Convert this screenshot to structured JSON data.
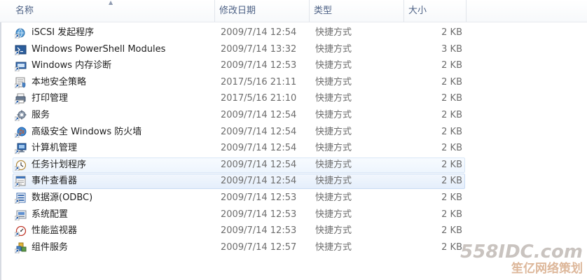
{
  "columns": {
    "name": "名称",
    "date": "修改日期",
    "type": "类型",
    "size": "大小"
  },
  "rows": [
    {
      "name": "iSCSI 发起程序",
      "date": "2009/7/14 12:54",
      "type": "快捷方式",
      "size": "2 KB",
      "icon": "iscsi-globe-icon",
      "state": "normal"
    },
    {
      "name": "Windows PowerShell Modules",
      "date": "2009/7/14 13:32",
      "type": "快捷方式",
      "size": "3 KB",
      "icon": "powershell-icon",
      "state": "normal"
    },
    {
      "name": "Windows 内存诊断",
      "date": "2009/7/14 12:53",
      "type": "快捷方式",
      "size": "2 KB",
      "icon": "memory-diagnostic-icon",
      "state": "normal"
    },
    {
      "name": "本地安全策略",
      "date": "2017/5/16 21:11",
      "type": "快捷方式",
      "size": "2 KB",
      "icon": "security-policy-icon",
      "state": "normal"
    },
    {
      "name": "打印管理",
      "date": "2017/5/16 21:10",
      "type": "快捷方式",
      "size": "2 KB",
      "icon": "printer-icon",
      "state": "normal"
    },
    {
      "name": "服务",
      "date": "2009/7/14 12:54",
      "type": "快捷方式",
      "size": "2 KB",
      "icon": "services-gear-icon",
      "state": "normal"
    },
    {
      "name": "高级安全 Windows 防火墙",
      "date": "2009/7/14 12:54",
      "type": "快捷方式",
      "size": "2 KB",
      "icon": "firewall-icon",
      "state": "normal"
    },
    {
      "name": "计算机管理",
      "date": "2009/7/14 12:54",
      "type": "快捷方式",
      "size": "2 KB",
      "icon": "computer-management-icon",
      "state": "normal"
    },
    {
      "name": "任务计划程序",
      "date": "2009/7/14 12:54",
      "type": "快捷方式",
      "size": "2 KB",
      "icon": "task-scheduler-clock-icon",
      "state": "hover"
    },
    {
      "name": "事件查看器",
      "date": "2009/7/14 12:54",
      "type": "快捷方式",
      "size": "2 KB",
      "icon": "event-viewer-icon",
      "state": "selected"
    },
    {
      "name": "数据源(ODBC)",
      "date": "2009/7/14 12:53",
      "type": "快捷方式",
      "size": "2 KB",
      "icon": "odbc-datasource-icon",
      "state": "normal"
    },
    {
      "name": "系统配置",
      "date": "2009/7/14 12:53",
      "type": "快捷方式",
      "size": "2 KB",
      "icon": "system-config-icon",
      "state": "normal"
    },
    {
      "name": "性能监视器",
      "date": "2009/7/14 12:53",
      "type": "快捷方式",
      "size": "2 KB",
      "icon": "performance-monitor-icon",
      "state": "normal"
    },
    {
      "name": "组件服务",
      "date": "2009/7/14 12:57",
      "type": "快捷方式",
      "size": "2 KB",
      "icon": "component-services-icon",
      "state": "normal"
    }
  ],
  "watermark": {
    "domain": "558IDC.com",
    "subtitle": "笙亿网络策划"
  },
  "colors": {
    "header_text": "#4d6185",
    "row_text": "#1e1e1e",
    "meta_text": "#6d6d6d",
    "hover_bg": "#eef5fd",
    "selected_bg": "#e4eefb",
    "selected_border": "#c9dcf4"
  }
}
